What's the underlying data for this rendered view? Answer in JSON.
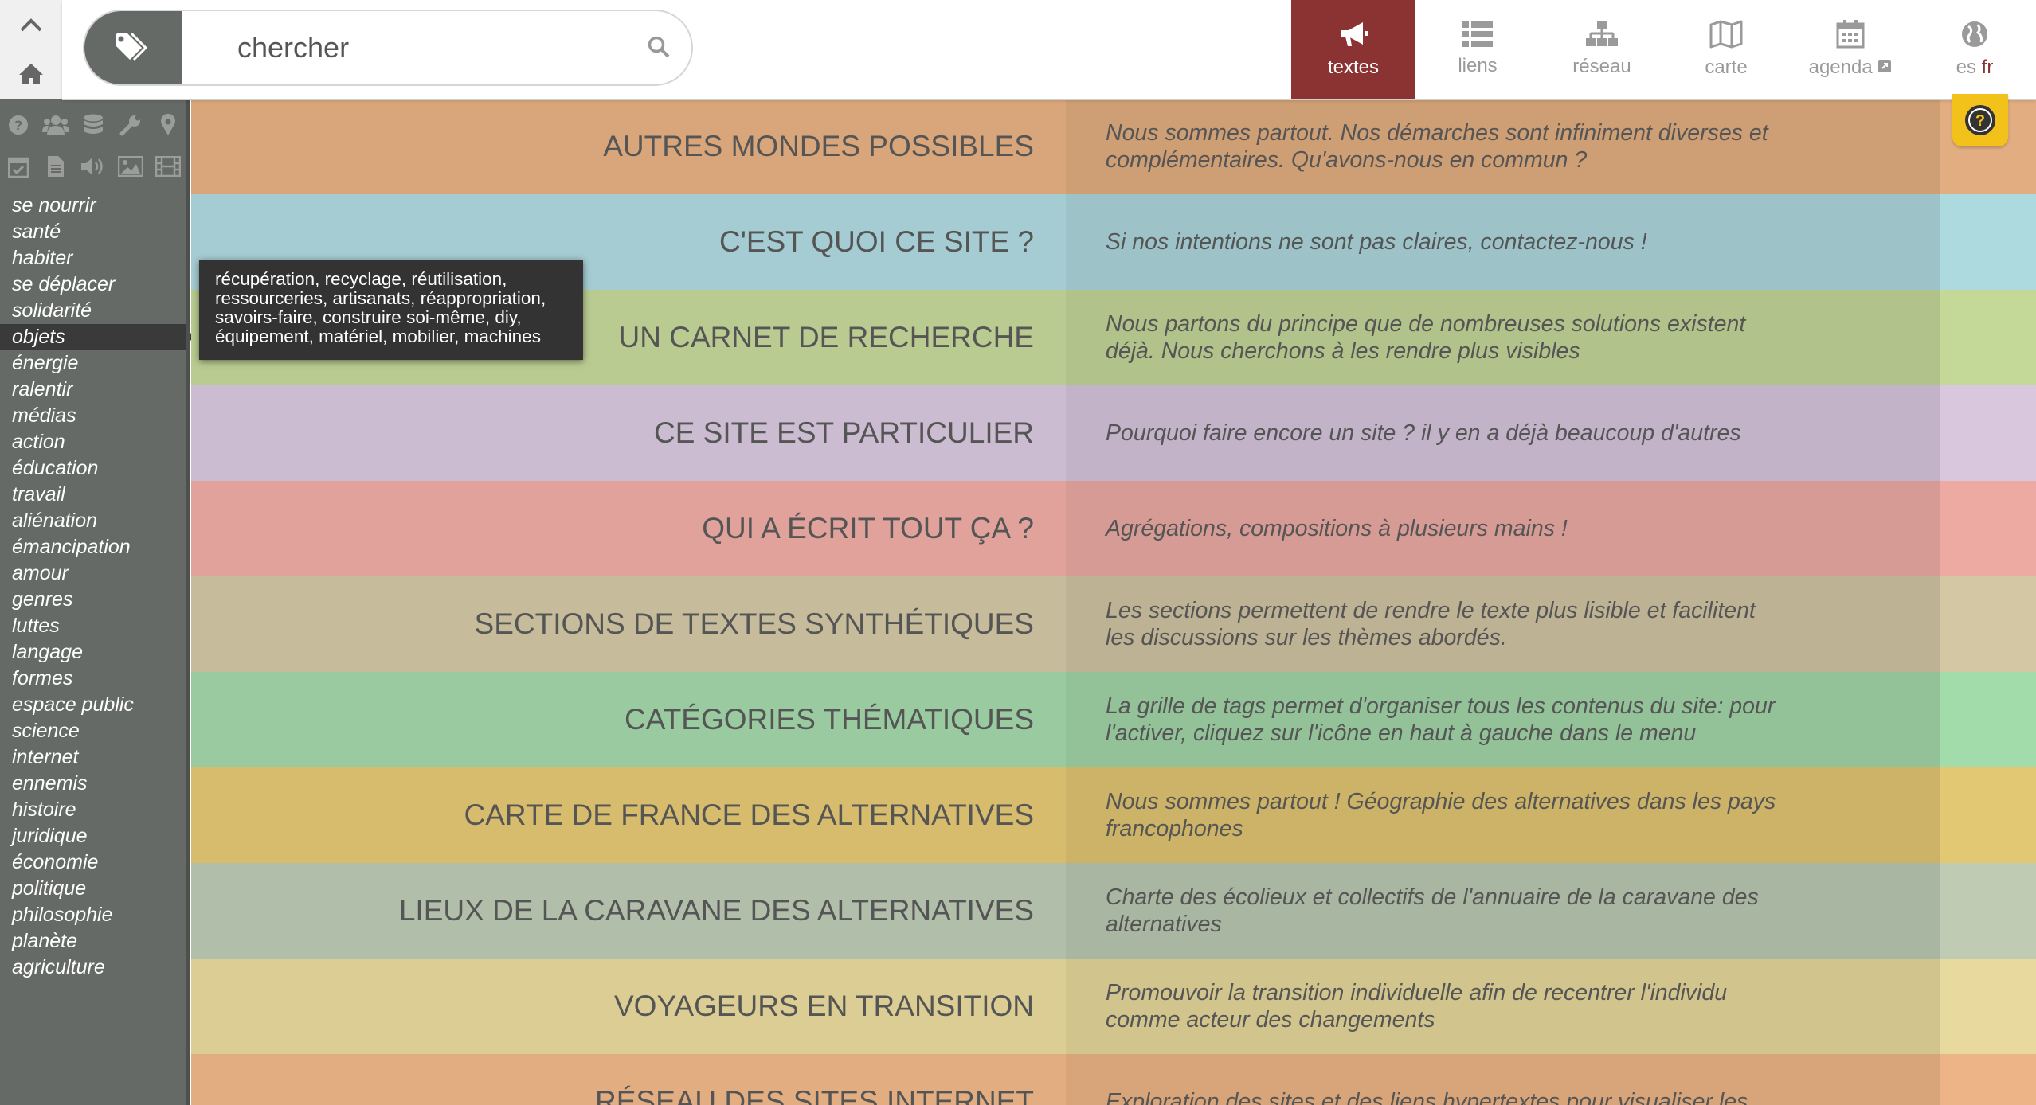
{
  "search": {
    "placeholder": "chercher"
  },
  "nav": [
    {
      "label": "textes",
      "icon": "megaphone-icon",
      "active": true
    },
    {
      "label": "liens",
      "icon": "list-icon"
    },
    {
      "label": "réseau",
      "icon": "sitemap-icon"
    },
    {
      "label": "carte",
      "icon": "map-icon"
    },
    {
      "label": "agenda",
      "icon": "calendar-icon"
    },
    {
      "label_es": "es",
      "label_fr": "fr",
      "icon": "globe-icon"
    }
  ],
  "sidebar": {
    "tags": [
      "se nourrir",
      "santé",
      "habiter",
      "se déplacer",
      "solidarité",
      "objets",
      "énergie",
      "ralentir",
      "médias",
      "action",
      "éducation",
      "travail",
      "aliénation",
      "émancipation",
      "amour",
      "genres",
      "luttes",
      "langage",
      "formes",
      "espace public",
      "science",
      "internet",
      "ennemis",
      "histoire",
      "juridique",
      "économie",
      "politique",
      "philosophie",
      "planète",
      "agriculture"
    ],
    "selected": "objets",
    "tooltip": "récupération, recyclage, réutilisation, ressourceries, artisanats, réappropriation, savoirs-faire, construire soi-même, diy, équipement, matériel, mobilier, machines"
  },
  "rows": [
    {
      "title": "AUTRES MONDES POSSIBLES",
      "desc": "Nous sommes partout. Nos démarches sont infiniment diverses et complémentaires. Qu'avons-nous en commun ?",
      "color": "#d8a67a",
      "edge": "#e2ad80"
    },
    {
      "title": "C'EST QUOI CE SITE ?",
      "desc": "Si nos intentions ne sont pas claires, contactez-nous !",
      "color": "#a5ccd2",
      "edge": "#addadf"
    },
    {
      "title": "UN CARNET DE RECHERCHE",
      "desc": "Nous partons du principe que de nombreuses solutions existent déjà. Nous cherchons à les rendre plus visibles",
      "color": "#b9cb91",
      "edge": "#c4d898"
    },
    {
      "title": "CE SITE EST PARTICULIER",
      "desc": "Pourquoi faire encore un site ? il y en a déjà beaucoup d'autres",
      "color": "#cbbcd1",
      "edge": "#d9c8dd"
    },
    {
      "title": "QUI A ÉCRIT TOUT ÇA ?",
      "desc": "Agrégations, compositions à plusieurs mains !",
      "color": "#e1a29c",
      "edge": "#ecaaa2"
    },
    {
      "title": "SECTIONS DE TEXTES SYNTHÉTIQUES",
      "desc": "Les sections permettent de rendre le texte plus lisible et facilitent les discussions sur les thèmes abordés.",
      "color": "#c6bb9a",
      "edge": "#d4c8a4"
    },
    {
      "title": "CATÉGORIES THÉMATIQUES",
      "desc": "La grille de tags permet d'organiser tous les contenus du site: pour l'activer, cliquez sur l'icône en haut à gauche dans le menu",
      "color": "#9acba0",
      "edge": "#a3dcab"
    },
    {
      "title": "CARTE DE FRANCE DES ALTERNATIVES",
      "desc": "Nous sommes partout ! Géographie des alternatives dans les pays francophones",
      "color": "#d6bc6c",
      "edge": "#e3c874"
    },
    {
      "title": "LIEUX DE LA CARAVANE DES ALTERNATIVES",
      "desc": "Charte des écolieux et collectifs de l'annuaire de la caravane des alternatives",
      "color": "#b1bfaa",
      "edge": "#c0cbb4"
    },
    {
      "title": "VOYAGEURS EN TRANSITION",
      "desc": "Promouvoir la transition individuelle afin de recentrer l'individu comme acteur des changements",
      "color": "#dccd94",
      "edge": "#e8d99f"
    },
    {
      "title": "RÉSEAU DES SITES INTERNET",
      "desc": "Exploration des sites et des liens hypertextes pour visualiser les",
      "color": "#e2ad80",
      "edge": "#ecb487"
    }
  ]
}
